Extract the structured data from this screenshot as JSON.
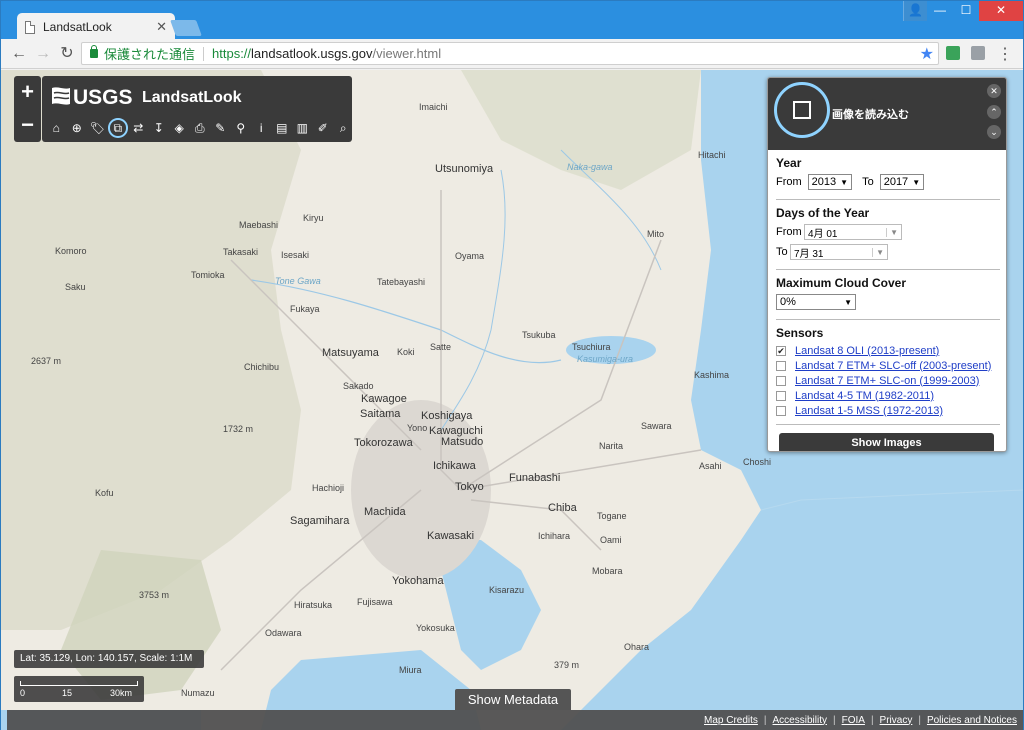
{
  "browser": {
    "tab_title": "LandsatLook",
    "tab_close": "✕",
    "secure_label": "保護された通信",
    "url_scheme": "https://",
    "url_host": "landsatlook.usgs.gov",
    "url_path": "/viewer.html",
    "nav_back": "←",
    "nav_forward": "→",
    "nav_reload": "↻",
    "star": "★",
    "menu": "⋮",
    "win_user": "👤",
    "win_min": "—",
    "win_max": "☐",
    "win_close": "✕"
  },
  "app": {
    "brand_logo_text": "USGS",
    "brand_title": "LandsatLook",
    "zoom_in": "+",
    "zoom_out": "−",
    "tools": [
      "⌂",
      "⊕",
      "🏷",
      "⧉",
      "⇄",
      "↧",
      "◈",
      "⎙",
      "✎",
      "⚲",
      "i",
      "▤",
      "▥",
      "✐",
      "⌕"
    ]
  },
  "map": {
    "coordinates": "Lat: 35.129, Lon: 140.157, Scale: 1:1M",
    "scale_labels": [
      "0",
      "15",
      "30km"
    ],
    "show_metadata": "Show Metadata",
    "footer_links": [
      "Map Credits",
      "Accessibility",
      "FOIA",
      "Privacy",
      "Policies and Notices"
    ],
    "labels": [
      {
        "text": "Imaichi",
        "cls": ""
      },
      {
        "text": "Hitachi",
        "cls": ""
      },
      {
        "text": "Utsunomiya",
        "cls": "big"
      },
      {
        "text": "Maebashi",
        "cls": ""
      },
      {
        "text": "Kiryu",
        "cls": ""
      },
      {
        "text": "Mito",
        "cls": ""
      },
      {
        "text": "Komoro",
        "cls": ""
      },
      {
        "text": "Takasaki",
        "cls": ""
      },
      {
        "text": "Isesaki",
        "cls": ""
      },
      {
        "text": "Oyama",
        "cls": ""
      },
      {
        "text": "Tomioka",
        "cls": ""
      },
      {
        "text": "Tatebayashi",
        "cls": ""
      },
      {
        "text": "Saku",
        "cls": ""
      },
      {
        "text": "Fukaya",
        "cls": ""
      },
      {
        "text": "Tsukuba",
        "cls": ""
      },
      {
        "text": "Tsuchiura",
        "cls": ""
      },
      {
        "text": "Matsuyama",
        "cls": "big"
      },
      {
        "text": "Koki",
        "cls": ""
      },
      {
        "text": "Satte",
        "cls": ""
      },
      {
        "text": "Chichibu",
        "cls": ""
      },
      {
        "text": "Kashima",
        "cls": ""
      },
      {
        "text": "Sakado",
        "cls": ""
      },
      {
        "text": "Kawagoe",
        "cls": "big"
      },
      {
        "text": "Saitama",
        "cls": "big"
      },
      {
        "text": "Koshigaya",
        "cls": "big"
      },
      {
        "text": "Yono",
        "cls": ""
      },
      {
        "text": "Kawaguchi",
        "cls": "big"
      },
      {
        "text": "Matsudo",
        "cls": "big"
      },
      {
        "text": "Sawara",
        "cls": ""
      },
      {
        "text": "Tokorozawa",
        "cls": "big"
      },
      {
        "text": "Narita",
        "cls": ""
      },
      {
        "text": "Choshi",
        "cls": ""
      },
      {
        "text": "Asahi",
        "cls": ""
      },
      {
        "text": "Ichikawa",
        "cls": "big"
      },
      {
        "text": "Hachioji",
        "cls": ""
      },
      {
        "text": "Tokyo",
        "cls": "big"
      },
      {
        "text": "Funabashi",
        "cls": "big"
      },
      {
        "text": "Kofu",
        "cls": ""
      },
      {
        "text": "Machida",
        "cls": "big"
      },
      {
        "text": "Chiba",
        "cls": "big"
      },
      {
        "text": "Togane",
        "cls": ""
      },
      {
        "text": "Sagamihara",
        "cls": "big"
      },
      {
        "text": "Kawasaki",
        "cls": "big"
      },
      {
        "text": "Ichihara",
        "cls": ""
      },
      {
        "text": "Oami",
        "cls": ""
      },
      {
        "text": "Yokohama",
        "cls": "big"
      },
      {
        "text": "Mobara",
        "cls": ""
      },
      {
        "text": "Kisarazu",
        "cls": ""
      },
      {
        "text": "Hiratsuka",
        "cls": ""
      },
      {
        "text": "Fujisawa",
        "cls": ""
      },
      {
        "text": "Yokosuka",
        "cls": ""
      },
      {
        "text": "Odawara",
        "cls": ""
      },
      {
        "text": "Ohara",
        "cls": ""
      },
      {
        "text": "Miura",
        "cls": ""
      },
      {
        "text": "Numazu",
        "cls": ""
      },
      {
        "text": "2637 m",
        "cls": ""
      },
      {
        "text": "1732 m",
        "cls": ""
      },
      {
        "text": "3753 m",
        "cls": ""
      },
      {
        "text": "379 m",
        "cls": ""
      },
      {
        "text": "Kasumiga-ura",
        "cls": "water"
      },
      {
        "text": "Tone Gawa",
        "cls": "water"
      },
      {
        "text": "Naka-gawa",
        "cls": "water"
      }
    ]
  },
  "panel": {
    "load_title": "画像を読み込む",
    "ctrl_close": "✕",
    "ctrl_up": "⌃",
    "ctrl_down": "⌄",
    "year": {
      "title": "Year",
      "from_label": "From",
      "from_value": "2013",
      "to_label": "To",
      "to_value": "2017"
    },
    "days": {
      "title": "Days of the Year",
      "from_label": "From",
      "from_value": "4月 01",
      "to_label": "To",
      "to_value": "7月 31"
    },
    "cloud": {
      "title": "Maximum Cloud Cover",
      "value": "0%"
    },
    "sensors": {
      "title": "Sensors",
      "items": [
        {
          "label": "Landsat 8 OLI (2013-present)",
          "checked": true
        },
        {
          "label": "Landsat 7 ETM+ SLC-off (2003-present)",
          "checked": false
        },
        {
          "label": "Landsat 7 ETM+ SLC-on (1999-2003)",
          "checked": false
        },
        {
          "label": "Landsat 4-5 TM (1982-2011)",
          "checked": false
        },
        {
          "label": "Landsat 1-5 MSS (1972-2013)",
          "checked": false
        }
      ]
    },
    "show_images": "Show Images"
  }
}
